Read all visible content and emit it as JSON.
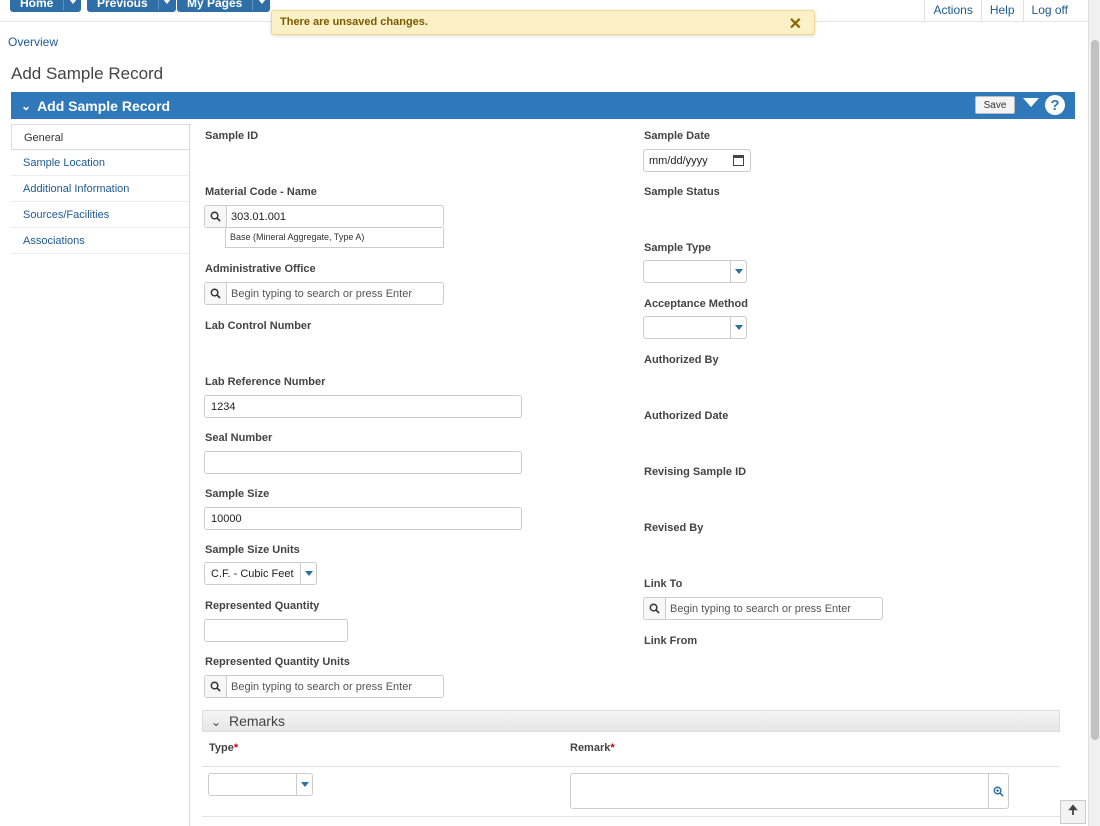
{
  "nav": {
    "home": "Home",
    "previous": "Previous",
    "my_pages": "My Pages",
    "actions": "Actions",
    "help": "Help",
    "logoff": "Log off"
  },
  "toast": {
    "message": "There are unsaved changes.",
    "close": "✕"
  },
  "breadcrumb": "Overview",
  "page_title": "Add Sample Record",
  "panel": {
    "title": "Add Sample Record",
    "save": "Save",
    "help": "?"
  },
  "left_nav": [
    "General",
    "Sample Location",
    "Additional Information",
    "Sources/Facilities",
    "Associations"
  ],
  "left_fields": {
    "sample_id_label": "Sample ID",
    "material_label": "Material Code - Name",
    "material_value": "303.01.001",
    "material_hint": "Base (Mineral Aggregate, Type A)",
    "admin_office_label": "Administrative Office",
    "admin_office_placeholder": "Begin typing to search or press Enter",
    "lab_control_label": "Lab Control Number",
    "lab_ref_label": "Lab Reference Number",
    "lab_ref_value": "1234",
    "seal_label": "Seal Number",
    "seal_value": "",
    "sample_size_label": "Sample Size",
    "sample_size_value": "10000",
    "size_units_label": "Sample Size Units",
    "size_units_value": "C.F. - Cubic Feet",
    "rep_qty_label": "Represented Quantity",
    "rep_qty_value": "",
    "rep_qty_units_label": "Represented Quantity Units",
    "rep_qty_units_placeholder": "Begin typing to search or press Enter"
  },
  "right_fields": {
    "sample_date_label": "Sample Date",
    "sample_date_value": "mm/dd/yyyy",
    "sample_status_label": "Sample Status",
    "sample_type_label": "Sample Type",
    "acceptance_label": "Acceptance Method",
    "authorized_by_label": "Authorized By",
    "authorized_date_label": "Authorized Date",
    "revising_label": "Revising Sample ID",
    "revised_by_label": "Revised By",
    "link_to_label": "Link To",
    "link_to_placeholder": "Begin typing to search or press Enter",
    "link_from_label": "Link From"
  },
  "remarks": {
    "title": "Remarks",
    "type_label": "Type",
    "remark_label": "Remark",
    "required": "*"
  }
}
